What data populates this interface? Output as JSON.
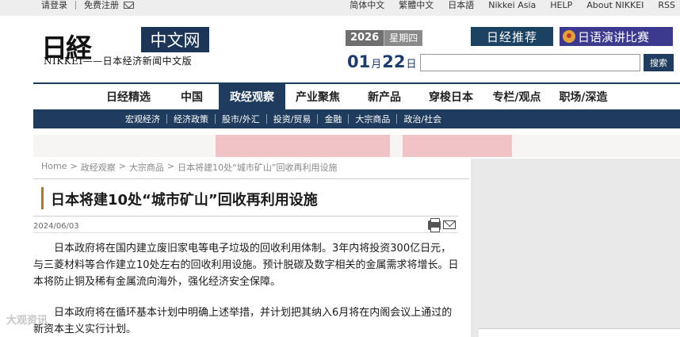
{
  "topbar": {
    "login": "请登录",
    "register": "免费注册",
    "links": [
      "简体中文",
      "繁體中文",
      "日本語",
      "Nikkei Asia",
      "HELP",
      "About NIKKEI",
      "RSS"
    ]
  },
  "logo": {
    "kanji": "日経",
    "box_text": "中文网",
    "subtitle": "NIKKEI——日本经济新闻中文版"
  },
  "date": {
    "year": "2026",
    "weekday": "星期四",
    "month": "01",
    "month_unit": "月",
    "day": "22",
    "day_unit": "日"
  },
  "promos": {
    "recommend": "日经推荐",
    "contest": "日语演讲比赛"
  },
  "search": {
    "placeholder": "",
    "button": "搜索"
  },
  "main_nav": [
    "日经精选",
    "中国",
    "政经观察",
    "产业聚焦",
    "新产品",
    "穿梭日本",
    "专栏/观点",
    "职场/深造"
  ],
  "main_nav_active": "政经观察",
  "sub_nav": [
    "宏观经济",
    "经济政策",
    "股市/外汇",
    "投资/贸易",
    "金融",
    "大宗商品",
    "政治/社会"
  ],
  "breadcrumb": [
    "Home",
    "政经观察",
    "大宗商品",
    "日本将建10处“城市矿山”回收再利用设施"
  ],
  "article": {
    "title": "日本将建10处“城市矿山”回收再利用设施",
    "date": "2024/06/03",
    "para1": "日本政府将在国内建立废旧家电等电子垃圾的回收利用体制。3年内将投资300亿日元，与三菱材料等合作建立10处左右的回收利用设施。预计脱碳及数字相关的金属需求将增长。日本将防止铜及稀有金属流向海外，强化经济安全保障。",
    "para2": "日本政府将在循环基本计划中明确上述举措，并计划把其纳入6月将在内阁会议上通过的新资本主义实行计划。"
  },
  "watermark": "大观资讯"
}
